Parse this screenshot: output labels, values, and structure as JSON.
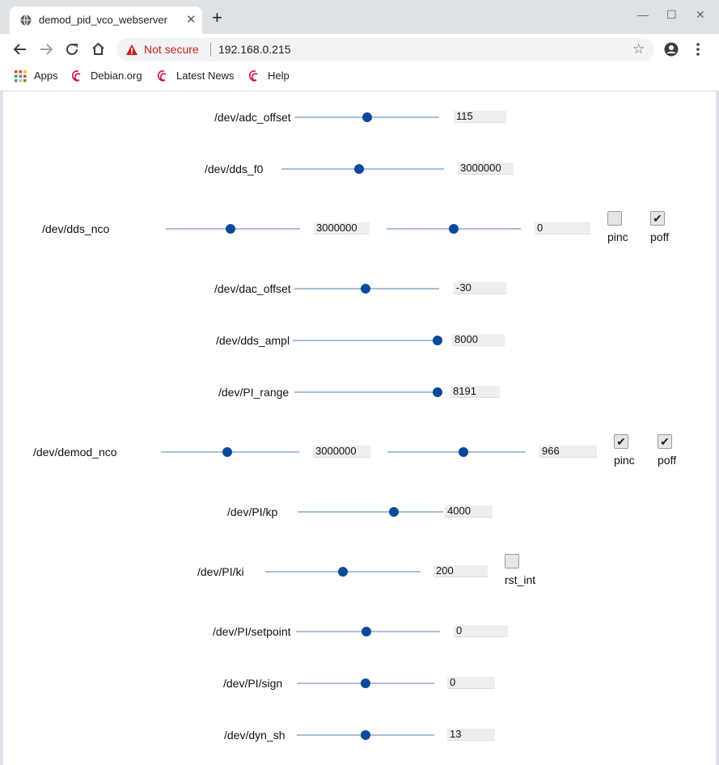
{
  "browser": {
    "tab_title": "demod_pid_vco_webserver",
    "tab_close": "✕",
    "new_tab": "+",
    "minimize": "—",
    "maximize": "☐",
    "close": "✕",
    "security_label": "Not secure",
    "url": "192.168.0.215",
    "bookmarks": [
      "Apps",
      "Debian.org",
      "Latest News",
      "Help"
    ]
  },
  "rows": [
    {
      "label": "/dev/adc_offset",
      "value": "115"
    },
    {
      "label": "/dev/dds_f0",
      "value": "3000000"
    },
    {
      "label": "/dev/dds_nco",
      "value1": "3000000",
      "value2": "0",
      "cb1_label": "pinc",
      "cb1_checked": false,
      "cb2_label": "poff",
      "cb2_checked": true
    },
    {
      "label": "/dev/dac_offset",
      "value": "-30"
    },
    {
      "label": "/dev/dds_ampl",
      "value": "8000"
    },
    {
      "label": "/dev/PI_range",
      "value": "8191"
    },
    {
      "label": "/dev/demod_nco",
      "value1": "3000000",
      "value2": "966",
      "cb1_label": "pinc",
      "cb1_checked": true,
      "cb2_label": "poff",
      "cb2_checked": true
    },
    {
      "label": "/dev/PI/kp",
      "value": "4000"
    },
    {
      "label": "/dev/PI/ki",
      "value": "200",
      "cb1_label": "rst_int",
      "cb1_checked": false
    },
    {
      "label": "/dev/PI/setpoint",
      "value": "0"
    },
    {
      "label": "/dev/PI/sign",
      "value": "0"
    },
    {
      "label": "/dev/dyn_sh",
      "value": "13"
    }
  ],
  "sliders": {
    "adc_offset": 0.5,
    "dds_f0": 0.48,
    "dds_nco_1": 0.48,
    "dds_nco_2": 0.5,
    "dac_offset": 0.49,
    "dds_ampl": 1.0,
    "pi_range": 1.0,
    "demod_nco_1": 0.48,
    "demod_nco_2": 0.55,
    "pi_kp": 0.66,
    "pi_ki": 0.5,
    "pi_setpoint": 0.49,
    "pi_sign": 0.5,
    "dyn_sh": 0.5
  },
  "colors": {
    "slider_thumb": "#0b4a9a",
    "slider_track": "#a8c0d8",
    "warning": "#c5221f"
  },
  "icons": [
    "globe-icon",
    "back-icon",
    "forward-icon",
    "reload-icon",
    "home-icon",
    "warning-icon",
    "star-icon",
    "account-icon",
    "menu-icon",
    "apps-icon",
    "debian-icon"
  ]
}
